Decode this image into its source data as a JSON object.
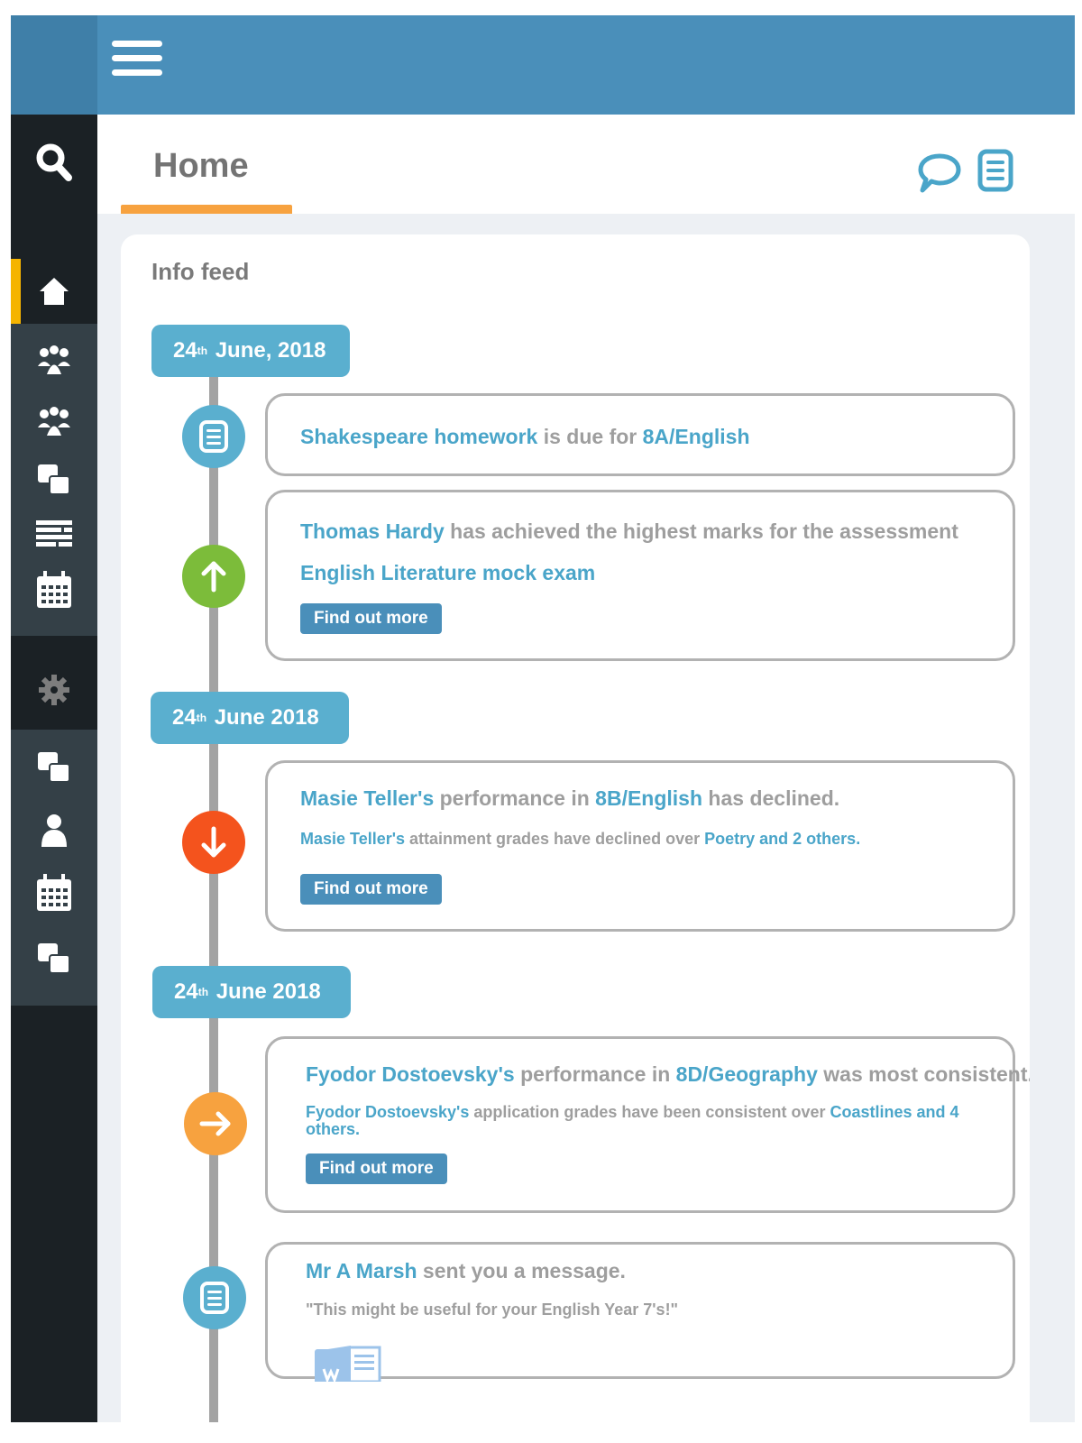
{
  "header": {
    "menu_icon": "hamburger-icon",
    "color": "#4a8fba"
  },
  "sidebar": {
    "top_icons": [
      "search-icon",
      "home-icon"
    ],
    "group1_icons": [
      "users-icon",
      "users-icon",
      "copy-icon",
      "list-icon",
      "calendar-icon"
    ],
    "settings_icon": "gear-icon",
    "group2_icons": [
      "copy-icon",
      "user-icon",
      "calendar-icon",
      "copy-icon"
    ],
    "active": "home",
    "active_color": "#f5b400"
  },
  "page": {
    "title": "Home",
    "chat_icon": "chat-icon",
    "list_icon": "list-icon"
  },
  "feed": {
    "title": "Info feed",
    "dates": [
      {
        "day": "24",
        "sup": "th",
        "rest": " June, 2018"
      },
      {
        "day": "24",
        "sup": "th",
        "rest": " June 2018"
      },
      {
        "day": "24",
        "sup": "th",
        "rest": " June 2018"
      }
    ],
    "items": [
      {
        "icon": "document-icon",
        "color": "#5aafcf",
        "a": "Shakespeare homework",
        "b": " is due for ",
        "c": "8A/English"
      },
      {
        "icon": "arrow-up-icon",
        "color": "#7cbc3a",
        "a": "Thomas Hardy",
        "b": " has achieved the highest marks for the assessment",
        "link": "English Literature mock exam",
        "button": "Find out more"
      },
      {
        "icon": "arrow-down-icon",
        "color": "#f4531d",
        "a": "Masie Teller's",
        "b": " performance in ",
        "c": "8B/English",
        "d": " has declined.",
        "sub_a": "Masie Teller's",
        "sub_b": " attainment grades have declined over ",
        "sub_c": "Poetry and 2 others.",
        "button": "Find out more"
      },
      {
        "icon": "arrow-right-icon",
        "color": "#f7a23f",
        "a": "Fyodor Dostoevsky's",
        "b": " performance in ",
        "c": "8D/Geography",
        "d": " was most consistent.",
        "sub_a": "Fyodor Dostoevsky's",
        "sub_b": " application grades have been consistent over ",
        "sub_c": "Coastlines and 4 others.",
        "button": "Find out more"
      },
      {
        "icon": "document-icon",
        "color": "#5aafcf",
        "a": "Mr A Marsh",
        "b": " sent you a message.",
        "quote": "\"This might be useful for your English Year 7's!\"",
        "attachment_icon": "word-document-icon"
      }
    ]
  }
}
